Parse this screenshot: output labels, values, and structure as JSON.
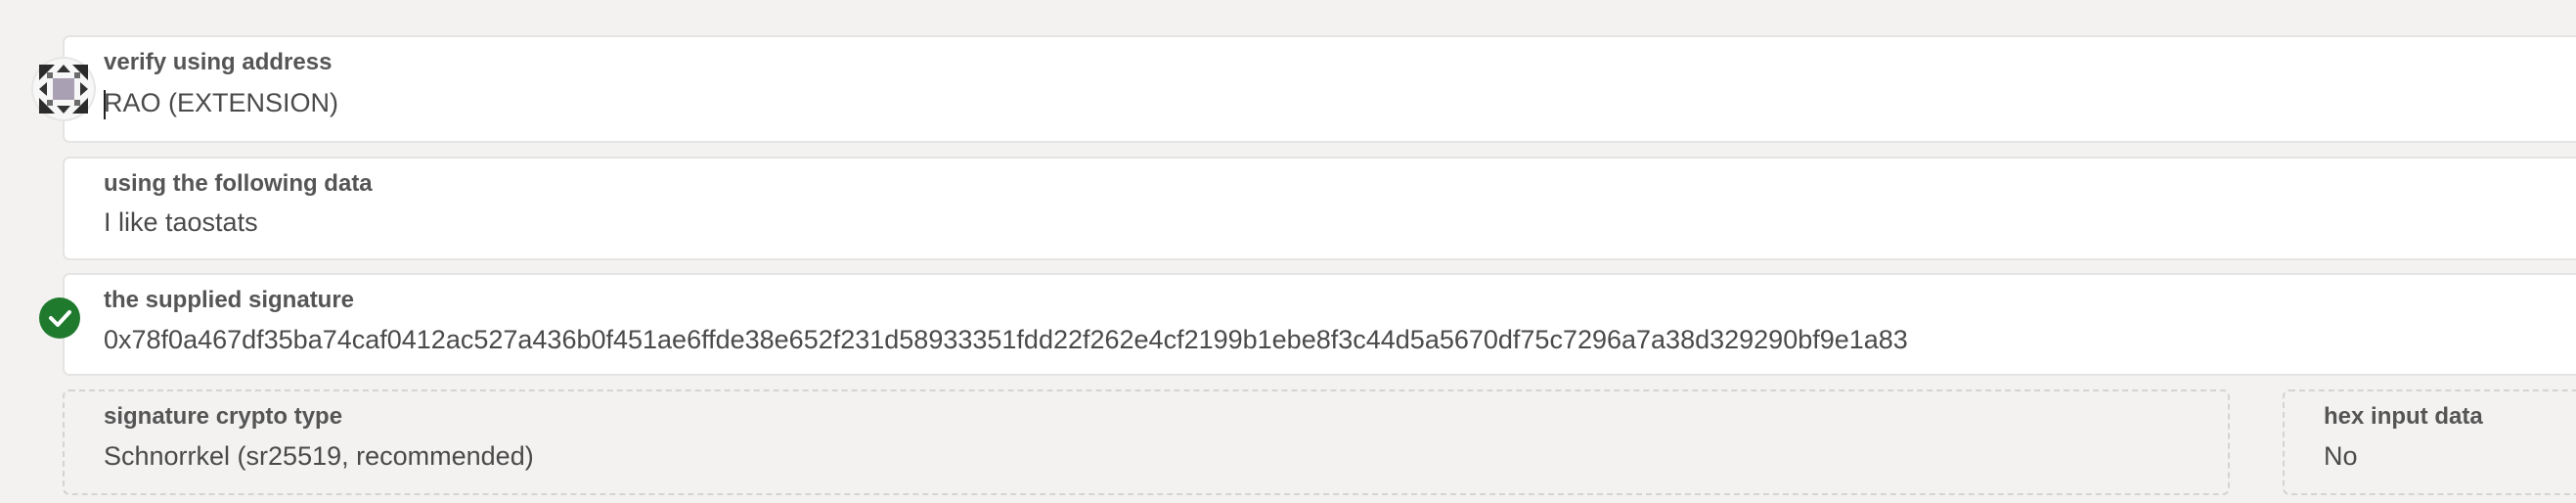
{
  "verify_address": {
    "label": "verify using address",
    "value": "RAO (EXTENSION)",
    "avatar_icon": "polkadot-identicon"
  },
  "data_field": {
    "label": "using the following data",
    "value": "I like taostats"
  },
  "signature": {
    "label": "the supplied signature",
    "value": "0x78f0a467df35ba74caf0412ac527a436b0f451ae6ffde38e652f231d58933351fdd22f262e4cf2199b1ebe8f3c44d5a5670df75c7296a7a38d329290bf9e1a83",
    "status_icon": "check-circle-icon",
    "status_color": "#1f7a2e"
  },
  "crypto_type": {
    "label": "signature crypto type",
    "value": "Schnorrkel (sr25519, recommended)"
  },
  "hex_input": {
    "label": "hex input data",
    "value": "No"
  }
}
